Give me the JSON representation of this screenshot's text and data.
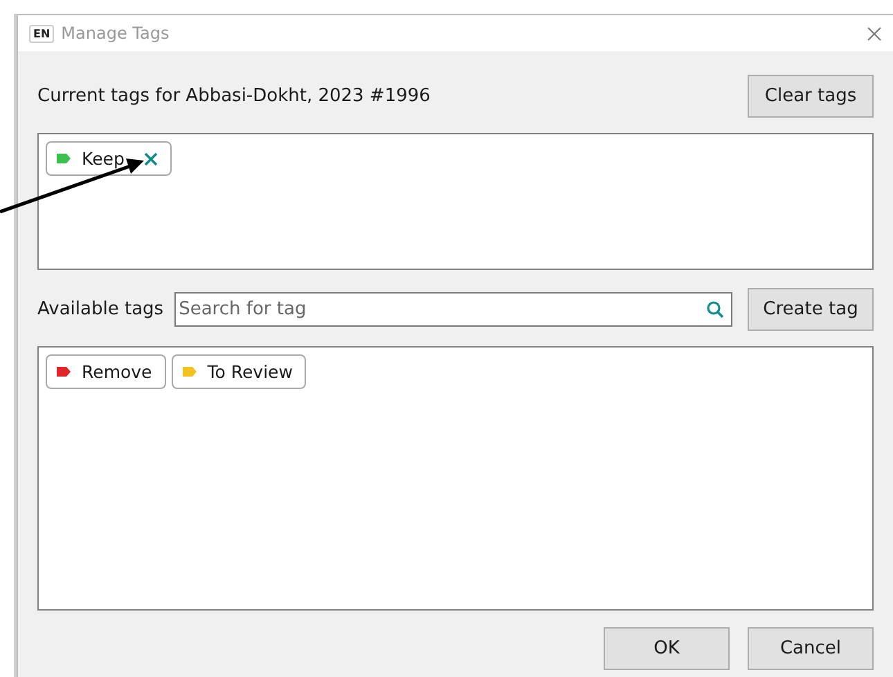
{
  "window": {
    "app_badge": "EN",
    "title": "Manage Tags"
  },
  "current": {
    "label": "Current tags for Abbasi-Dokht, 2023 #1996",
    "clear_button": "Clear tags",
    "tags": [
      {
        "label": "Keep",
        "color": "#3cc14e",
        "removable": true
      }
    ]
  },
  "available": {
    "label": "Available tags",
    "search": {
      "placeholder": "Search for tag"
    },
    "create_button": "Create tag",
    "tags": [
      {
        "label": "Remove",
        "color": "#e0252b",
        "removable": false
      },
      {
        "label": "To Review",
        "color": "#f3c221",
        "removable": false
      }
    ]
  },
  "buttons": [
    "OK",
    "Cancel"
  ]
}
